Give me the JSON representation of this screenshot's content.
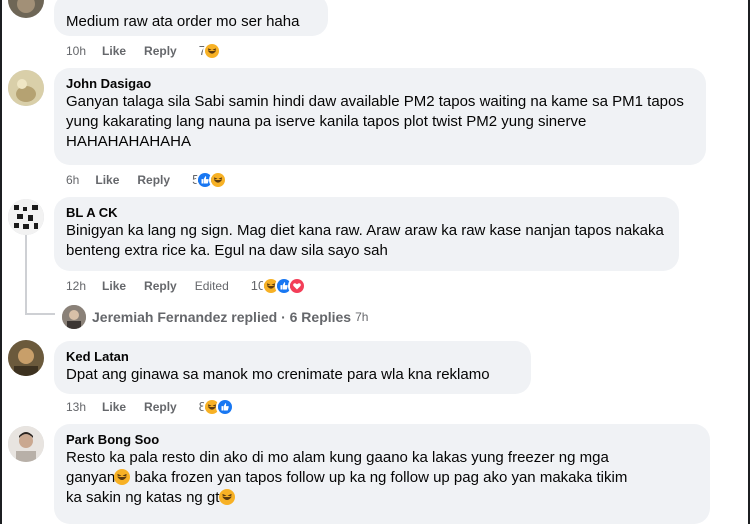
{
  "comments": [
    {
      "name": "",
      "text": "Medium raw ata order mo ser haha",
      "time": "10h",
      "like": "Like",
      "reply": "Reply",
      "reaction_count": "7",
      "reactions": [
        "haha-icon"
      ]
    },
    {
      "name": "John Dasigao",
      "text": "Ganyan talaga sila Sabi samin hindi daw available PM2 tapos waiting na kame sa PM1 tapos yung kakarating lang nauna pa iserve kanila tapos plot twist PM2 yung sinerve HAHAHAHAHAHA",
      "time": "6h",
      "like": "Like",
      "reply": "Reply",
      "reaction_count": "5",
      "reactions": [
        "like-icon",
        "haha-icon"
      ]
    },
    {
      "name": "BL A CK",
      "text": "Binigyan ka lang ng sign. Mag diet kana raw. Araw araw ka raw kase nanjan tapos nakaka benteng extra rice ka. Egul na daw sila sayo sah",
      "time": "12h",
      "like": "Like",
      "reply": "Reply",
      "edited": "Edited",
      "reaction_count": "10",
      "reactions": [
        "haha-icon",
        "like-icon",
        "love-icon"
      ],
      "replies_summary": {
        "text": "Jeremiah Fernandez replied · 6 Replies",
        "age": "7h"
      }
    },
    {
      "name": "Ked Latan",
      "text": "Dpat ang ginawa sa manok mo crenimate para wla kna reklamo",
      "time": "13h",
      "like": "Like",
      "reply": "Reply",
      "reaction_count": "8",
      "reactions": [
        "haha-icon",
        "like-icon"
      ]
    },
    {
      "name": "Park Bong Soo",
      "text_line1": "Resto ka pala resto din ako di mo alam kung gaano ka lakas yung freezer ng mga",
      "text_line2a": "ganyan ",
      "text_line2b": " baka frozen yan tapos follow up ka ng follow up pag ako yan makaka tikim",
      "text_line3": "ka sakin ng katas ng gt "
    }
  ],
  "colors": {
    "bubble": "#f0f2f5",
    "meta": "#65676b",
    "like_blue": "#1877f2",
    "love_red": "#f33e58",
    "haha_yellow": "#f7b125"
  }
}
